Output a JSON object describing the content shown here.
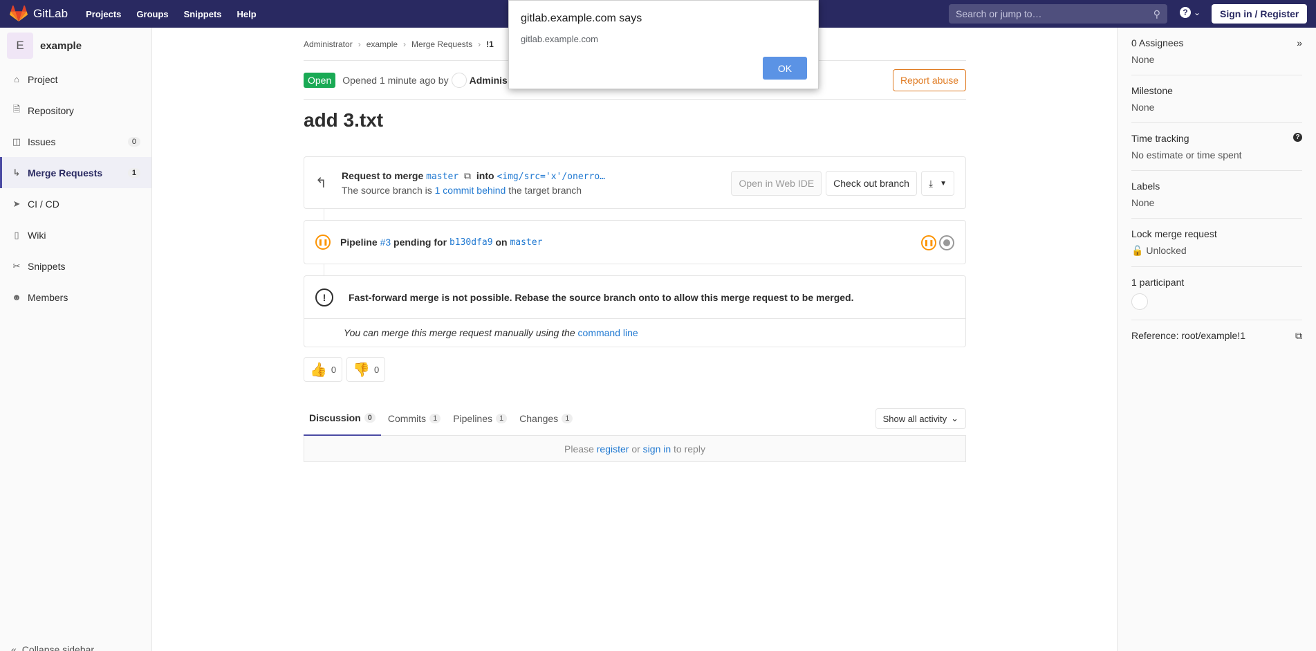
{
  "navbar": {
    "brand": "GitLab",
    "links": [
      "Projects",
      "Groups",
      "Snippets",
      "Help"
    ],
    "search_placeholder": "Search or jump to…",
    "signin_label": "Sign in / Register"
  },
  "sidebar": {
    "project_initial": "E",
    "project_name": "example",
    "items": [
      {
        "label": "Project",
        "icon": "home-icon"
      },
      {
        "label": "Repository",
        "icon": "doc-icon"
      },
      {
        "label": "Issues",
        "icon": "issues-icon",
        "count": "0"
      },
      {
        "label": "Merge Requests",
        "icon": "merge-request-icon",
        "count": "1"
      },
      {
        "label": "CI / CD",
        "icon": "rocket-icon"
      },
      {
        "label": "Wiki",
        "icon": "book-icon"
      },
      {
        "label": "Snippets",
        "icon": "scissors-icon"
      },
      {
        "label": "Members",
        "icon": "users-icon"
      }
    ],
    "collapse_label": "Collapse sidebar"
  },
  "breadcrumb": [
    "Administrator",
    "example",
    "Merge Requests",
    "!1"
  ],
  "mr": {
    "status": "Open",
    "opened_text": "Opened 1 minute ago by",
    "author": "Adminis",
    "report_label": "Report abuse",
    "title": "add 3.txt"
  },
  "merge_info": {
    "request_prefix": "Request to merge",
    "source": "master",
    "into": "into",
    "target": "<img/src='x'/onerro…",
    "behind_prefix": "The source branch is",
    "behind_link": "1 commit behind",
    "behind_suffix": "the target branch",
    "web_ide_label": "Open in Web IDE",
    "checkout_label": "Check out branch"
  },
  "pipeline": {
    "prefix": "Pipeline",
    "id": "#3",
    "pending": "pending for",
    "sha": "b130dfa9",
    "on": "on",
    "branch": "master"
  },
  "ff": {
    "message": "Fast-forward merge is not possible. Rebase the source branch onto  to allow this merge request to be merged.",
    "manual_prefix": "You can merge this merge request manually using the",
    "manual_link": "command line"
  },
  "awards": {
    "thumbsup": "0",
    "thumbsdown": "0"
  },
  "tabs": [
    {
      "label": "Discussion",
      "count": "0"
    },
    {
      "label": "Commits",
      "count": "1"
    },
    {
      "label": "Pipelines",
      "count": "1"
    },
    {
      "label": "Changes",
      "count": "1"
    }
  ],
  "activity_label": "Show all activity",
  "reply": {
    "please": "Please",
    "register": "register",
    "or": "or",
    "signin": "sign in",
    "suffix": "to reply"
  },
  "right_sidebar": {
    "assignees_title": "0 Assignees",
    "assignees_value": "None",
    "milestone_title": "Milestone",
    "milestone_value": "None",
    "time_title": "Time tracking",
    "time_value": "No estimate or time spent",
    "labels_title": "Labels",
    "labels_value": "None",
    "lock_title": "Lock merge request",
    "lock_value": "Unlocked",
    "participants_title": "1 participant",
    "reference": "Reference: root/example!1"
  },
  "dialog": {
    "title": "gitlab.example.com says",
    "message": "gitlab.example.com",
    "ok_label": "OK"
  }
}
